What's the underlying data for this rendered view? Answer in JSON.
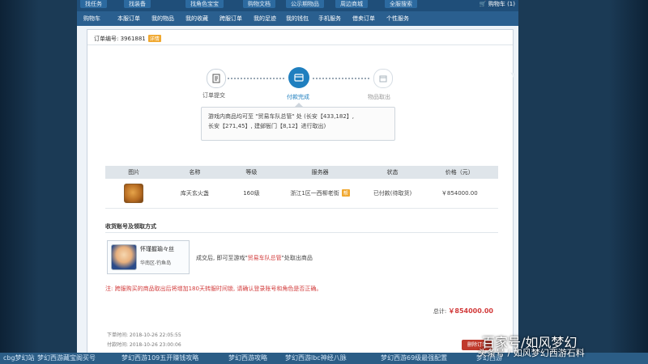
{
  "top_tabs": [
    "找任务",
    "找装备",
    "找角色宝宝",
    "购物文档",
    "公示期物品",
    "周边商城",
    "全服搜索"
  ],
  "cart_label": "购物车",
  "cart_count": "(1)",
  "sub_nav": [
    "购物车",
    "本服订单",
    "我的物品",
    "我的收藏",
    "跨服订单",
    "我的足迹",
    "我的钱包",
    "手机服务",
    "借卖订单",
    "个性服务"
  ],
  "order": {
    "label": "订单编号: 3961881",
    "badge": "详情"
  },
  "steps": [
    {
      "label": "订单提交",
      "state": "done"
    },
    {
      "label": "付款完成",
      "state": "active"
    },
    {
      "label": "物品取出",
      "state": "pending"
    }
  ],
  "tooltip": {
    "line1": "游戏内商品均可至 \"贸易车队总管\" 处 (长安【433,182】,",
    "line2": "长安【271,45】, 建邺衙门【8,12】进行取出)"
  },
  "table": {
    "headers": [
      "图片",
      "名称",
      "等级",
      "服务器",
      "状态",
      "价格（元）"
    ],
    "rows": [
      {
        "name": "库天玄火盏",
        "level": "160级",
        "server": "浙江1区一西柳老街",
        "server_badge": "帮",
        "status": "已付款(待取货)",
        "price": "￥854000.00"
      }
    ]
  },
  "receive": {
    "title": "收货账号及领取方式",
    "char_name": "怀瑾握瑜々丝",
    "char_server": "华南区-钓鱼岛",
    "pickup_prefix": "成交后, 即可至游戏\"",
    "pickup_highlight": "贸易车队总管",
    "pickup_suffix": "\"处取出商品"
  },
  "warning": "注: 跨服购买的商品取出后将增加180天转服时间锁, 请确认登录账号和角色是否正确。",
  "total": {
    "label": "总计:",
    "amount": "￥854000.00"
  },
  "times": {
    "order_time": "下单时间: 2018-10-26 22:05:55",
    "pay_time": "付款时间: 2018-10-26 23:00:06"
  },
  "delete_label": "删除订单",
  "bottom_links": [
    "cbg梦幻站",
    "梦幻西游藏宝阁买号",
    "梦幻西游109五开赚钱攻略",
    "梦幻西游攻略",
    "梦幻西游lbc神经八脉",
    "梦幻西游69级最强配置",
    "梦幻西游"
  ],
  "watermark": {
    "line1": "百家号/如风梦幻",
    "line2": "头条号 / 如风梦幻西游石料"
  },
  "colors": {
    "nav": "#1f4e79",
    "subnav": "#2a5f8f",
    "accent": "#1f7fbf",
    "warning": "#d23b3b",
    "badge": "#f0a830"
  }
}
